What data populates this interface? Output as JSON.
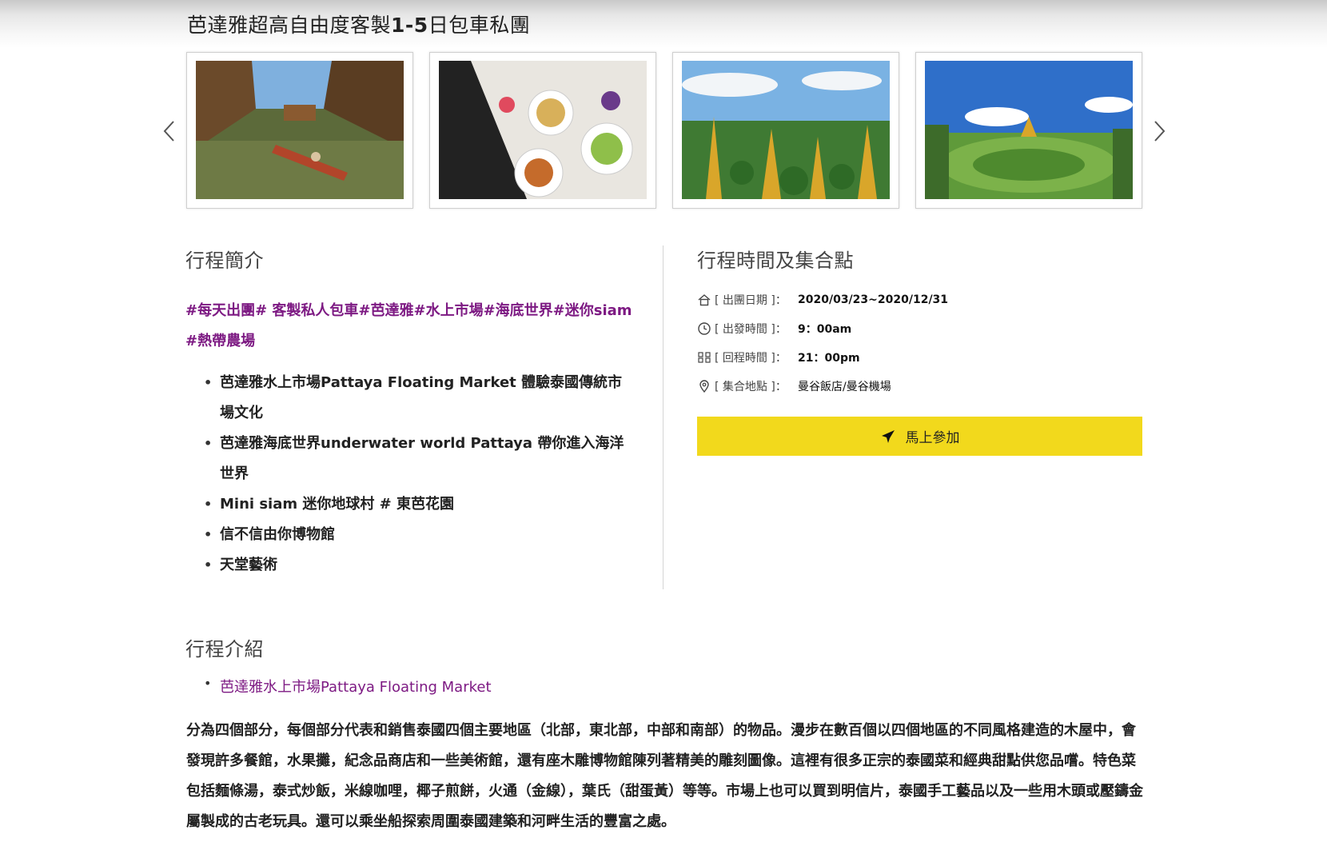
{
  "page": {
    "title_prefix": "芭達雅超高自由度客製",
    "title_bold": "1-5",
    "title_suffix": "日包車私團"
  },
  "carousel": {
    "prev_icon": "chevron-left-icon",
    "next_icon": "chevron-right-icon",
    "images": [
      "floating-market-photo",
      "thai-food-photo",
      "golden-pagoda-garden-photo",
      "nong-nooch-garden-photo"
    ]
  },
  "summary": {
    "heading": "行程簡介",
    "hashtags": "#每天出團# 客製私人包車#芭達雅#水上市場#海底世界#迷你siam #熱帶農場",
    "items": [
      "芭達雅水上市場Pattaya Floating Market 體驗泰國傳統市場文化",
      "芭達雅海底世界underwater world Pattaya 帶你進入海洋世界",
      "Mini siam  迷你地球村 # 東芭花園",
      "信不信由你博物館",
      "天堂藝術"
    ]
  },
  "schedule": {
    "heading": "行程時間及集合點",
    "rows": [
      {
        "icon": "home-icon",
        "label": "[ 出團日期 ]：",
        "value": "2020/03/23~2020/12/31"
      },
      {
        "icon": "clock-icon",
        "label": "[ 出發時間 ]：",
        "value": "9：00am"
      },
      {
        "icon": "return-icon",
        "label": "[ 回程時間 ]：",
        "value": "21：00pm"
      },
      {
        "icon": "location-pin-icon",
        "label": "[ 集合地點 ]：",
        "value": "曼谷飯店/曼谷機場"
      }
    ],
    "join_label": "馬上參加",
    "join_icon": "airplane-icon",
    "accent": "#f2d91c"
  },
  "intro": {
    "heading": "行程介紹",
    "link": "芭達雅水上市場Pattaya Floating Market",
    "paragraph": "分為四個部分，每個部分代表和銷售泰國四個主要地區（北部，東北部，中部和南部）的物品。漫步在數百個以四個地區的不同風格建造的木屋中，會發現許多餐館，水果攤，紀念品商店和一些美術館，還有座木雕博物館陳列著精美的雕刻圖像。這裡有很多正宗的泰國菜和經典甜點供您品嚐。特色菜包括麵條湯，泰式炒飯，米線咖哩，椰子煎餅，火通（金線），葉氏（甜蛋黃）等等。市場上也可以買到明信片，泰國手工藝品以及一些用木頭或壓鑄金屬製成的古老玩具。還可以乘坐船探索周圍泰國建築和河畔生活的豐富之處。"
  },
  "colors": {
    "link_purple": "#7d1a83"
  }
}
